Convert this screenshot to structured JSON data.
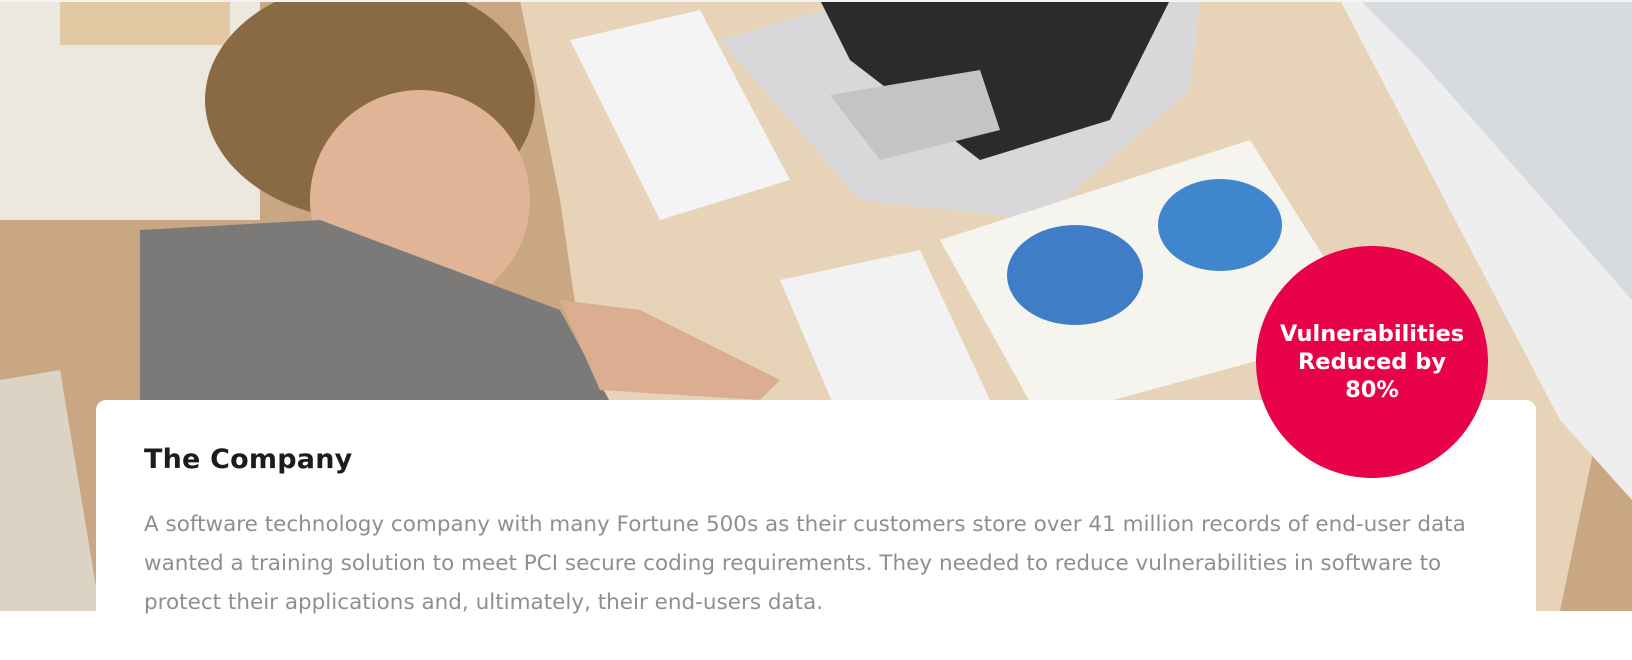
{
  "hero": {
    "image_description_icon": "photo-person-at-desk-icon"
  },
  "badge": {
    "text": "Vulnerabilities Reduced by 80%",
    "color": "#e8024a"
  },
  "card": {
    "title": "The Company",
    "body": "A software technology company with many Fortune 500s as their customers store over 41 million records of end-user data wanted a training solution to meet PCI secure coding requirements. They needed to reduce vulnerabilities in software to protect their applications and, ultimately, their end-users data."
  }
}
